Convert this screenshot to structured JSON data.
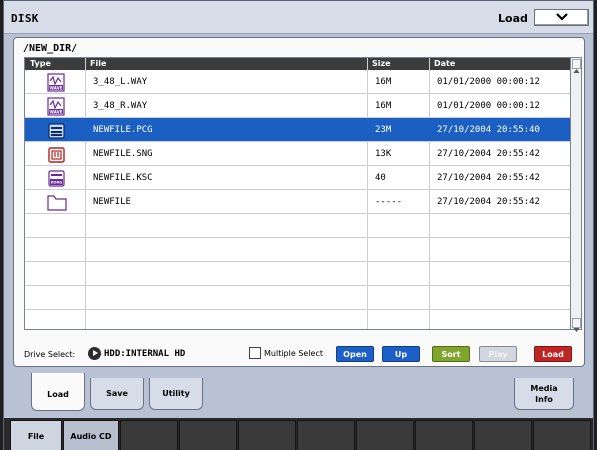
{
  "header": {
    "title": "DISK",
    "mode_label": "Load"
  },
  "path": "/NEW_DIR/",
  "columns": {
    "type": "Type",
    "file": "File",
    "size": "Size",
    "date": "Date"
  },
  "files": [
    {
      "icon": "wave-file-icon",
      "name": "3_48_L.WAY",
      "size": "16M",
      "date": "01/01/2000 00:00:12"
    },
    {
      "icon": "wave-file-icon",
      "name": "3_48_R.WAY",
      "size": "16M",
      "date": "01/01/2000 00:00:12"
    },
    {
      "icon": "pcg-file-icon",
      "name": "NEWFILE.PCG",
      "size": "23M",
      "date": "27/10/2004 20:55:40"
    },
    {
      "icon": "sng-file-icon",
      "name": "NEWFILE.SNG",
      "size": "13K",
      "date": "27/10/2004 20:55:42"
    },
    {
      "icon": "ksc-file-icon",
      "name": "NEWFILE.KSC",
      "size": "40",
      "date": "27/10/2004 20:55:42"
    },
    {
      "icon": "folder-icon",
      "name": "NEWFILE",
      "size": "-----",
      "date": "27/10/2004 20:55:42"
    }
  ],
  "footer": {
    "drive_label": "Drive Select:",
    "drive_value": "HDD:INTERNAL HD",
    "multiple_select": "Multiple Select",
    "buttons": {
      "open": "Open",
      "up": "Up",
      "sort": "Sort",
      "play": "Play",
      "load": "Load"
    }
  },
  "tabs": {
    "load": "Load",
    "save": "Save",
    "utility": "Utility",
    "media_line1": "Media",
    "media_line2": "Info"
  },
  "bottom_tabs": {
    "file": "File",
    "audio_cd": "Audio CD"
  },
  "colors": {
    "selected_row": "#1b5fc2",
    "blue_button": "#1d5fc8",
    "green_button": "#7fa52d",
    "red_button": "#c02424"
  }
}
